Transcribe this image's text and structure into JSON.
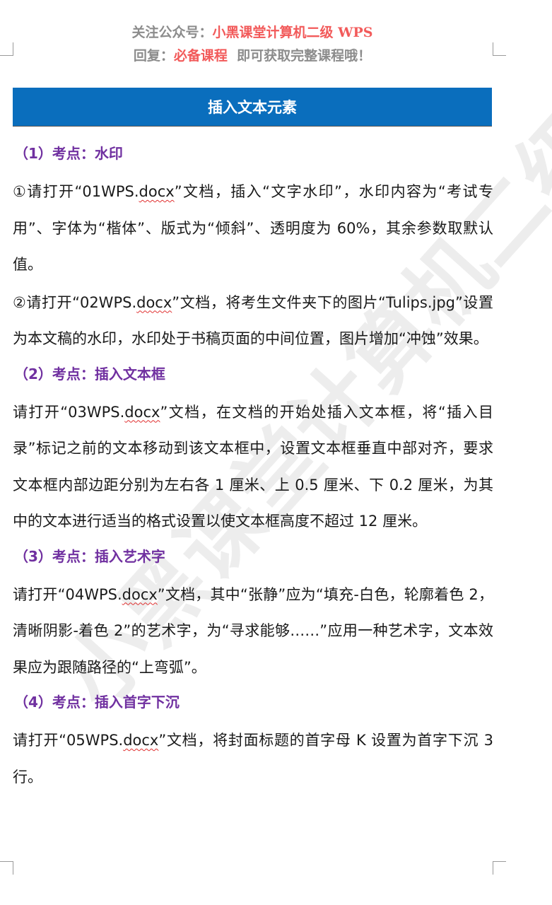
{
  "header": {
    "line1_prefix": "关注公众号：",
    "line1_accent": "小黑课堂计算机二级 WPS",
    "line2_prefix": "回复：",
    "line2_accent": "必备课程",
    "line2_suffix": "  即可获取完整课程哦！"
  },
  "watermark": "小黑课堂计算机二级WPS",
  "title": "插入文本元素",
  "sections": [
    {
      "heading": "（1）考点：水印",
      "paragraphs": [
        {
          "pre": "①请打开“01WPS.",
          "sq": "docx",
          "post": "”文档，插入“文字水印”，水印内容为“考试专用”、字体为“楷体”、版式为“倾斜”、透明度为 60%，其余参数取默认值。"
        },
        {
          "pre": "②请打开“02WPS.",
          "sq": "docx",
          "post": "”文档，将考生文件夹下的图片“Tulips.jpg”设置为本文稿的水印，水印处于书稿页面的中间位置，图片增加“冲蚀”效果。"
        }
      ]
    },
    {
      "heading": "（2）考点：插入文本框",
      "paragraphs": [
        {
          "pre": "请打开“03WPS.",
          "sq": "docx",
          "post": "”文档，在文档的开始处插入文本框，将“插入目录”标记之前的文本移动到该文本框中，设置文本框垂直中部对齐，要求文本框内部边距分别为左右各 1 厘米、上 0.5 厘米、下 0.2 厘米，为其中的文本进行适当的格式设置以使文本框高度不超过 12 厘米。"
        }
      ]
    },
    {
      "heading": "（3）考点：插入艺术字",
      "paragraphs": [
        {
          "pre": "请打开“04WPS.",
          "sq": "docx",
          "post": "”文档，其中“张静”应为“填充-白色，轮廓着色 2，清晰阴影-着色 2”的艺术字，为“寻求能够……”应用一种艺术字，文本效果应为跟随路径的“上弯弧”。"
        }
      ]
    },
    {
      "heading": "（4）考点：插入首字下沉",
      "paragraphs": [
        {
          "pre": "请打开“05WPS.",
          "sq": "docx",
          "post": "”文档，将封面标题的首字母 K 设置为首字下沉 3 行。"
        }
      ]
    }
  ]
}
